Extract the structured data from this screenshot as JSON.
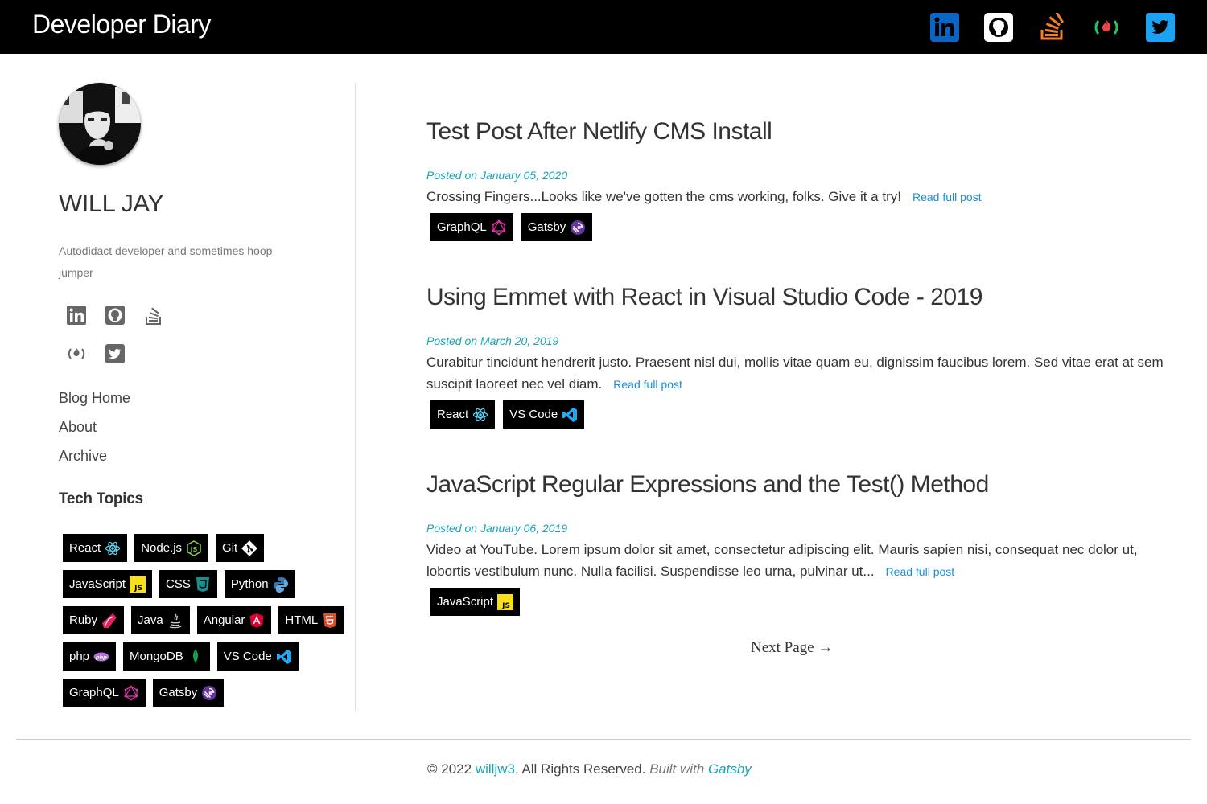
{
  "site": {
    "title": "Developer Diary"
  },
  "header": {
    "social": [
      {
        "name": "linkedin-icon",
        "color": "#0a66c2"
      },
      {
        "name": "github-icon",
        "color": "#ffffff"
      },
      {
        "name": "stackoverflow-icon",
        "color": "#f48024"
      },
      {
        "name": "freecodecamp-icon",
        "color": "#22c55e"
      },
      {
        "name": "twitter-icon",
        "color": "#1da1f2"
      }
    ]
  },
  "sidebar": {
    "author": "WILL JAY",
    "tagline": "Autodidact developer and sometimes hoop-jumper",
    "social": [
      "linkedin-icon",
      "github-icon",
      "stackoverflow-icon",
      "freecodecamp-icon",
      "twitter-icon"
    ],
    "nav": [
      "Blog Home",
      "About",
      "Archive"
    ],
    "topics_title": "Tech Topics",
    "topics": [
      {
        "label": "React",
        "icon": "react-icon"
      },
      {
        "label": "Node.js",
        "icon": "nodejs-icon"
      },
      {
        "label": "Git",
        "icon": "git-icon"
      },
      {
        "label": "JavaScript",
        "icon": "javascript-icon"
      },
      {
        "label": "CSS",
        "icon": "css-icon"
      },
      {
        "label": "Python",
        "icon": "python-icon"
      },
      {
        "label": "Ruby",
        "icon": "ruby-icon"
      },
      {
        "label": "Java",
        "icon": "java-icon"
      },
      {
        "label": "Angular",
        "icon": "angular-icon"
      },
      {
        "label": "HTML",
        "icon": "html-icon"
      },
      {
        "label": "php",
        "icon": "php-icon"
      },
      {
        "label": "MongoDB",
        "icon": "mongodb-icon"
      },
      {
        "label": "VS Code",
        "icon": "vscode-icon"
      },
      {
        "label": "GraphQL",
        "icon": "graphql-icon"
      },
      {
        "label": "Gatsby",
        "icon": "gatsby-icon"
      }
    ]
  },
  "posts": [
    {
      "title": "Test Post After Netlify CMS Install",
      "date": "Posted on January 05, 2020",
      "excerpt": "Crossing Fingers...Looks like we've gotten the cms working, folks. Give it a try!",
      "read_more": "Read full post",
      "tags": [
        {
          "label": "GraphQL",
          "icon": "graphql-icon"
        },
        {
          "label": "Gatsby",
          "icon": "gatsby-icon"
        }
      ]
    },
    {
      "title": "Using Emmet with React in Visual Studio Code - 2019",
      "date": "Posted on March 20, 2019",
      "excerpt": "Curabitur tincidunt hendrerit justo. Praesent nisl dui, mollis vitae quam eu, dignissim faucibus lorem. Sed vitae erat at sem suscipit laoreet nec vel diam.",
      "read_more": "Read full post",
      "tags": [
        {
          "label": "React",
          "icon": "react-icon"
        },
        {
          "label": "VS Code",
          "icon": "vscode-icon"
        }
      ]
    },
    {
      "title": "JavaScript Regular Expressions and the Test() Method",
      "date": "Posted on January 06, 2019",
      "excerpt": "Video at YouTube. Lorem ipsum dolor sit amet, consectetur adipiscing elit. Mauris sapien nisi, consequat nec dolor ut, lobortis vestibulum nunc. Nulla facilisi. Suspendisse leo urna, pulvinar ut...",
      "read_more": "Read full post",
      "tags": [
        {
          "label": "JavaScript",
          "icon": "javascript-icon"
        }
      ]
    }
  ],
  "pagination": {
    "next": "Next Page →"
  },
  "footer": {
    "copyright": "© 2022",
    "author_link": "willjw3",
    "rights": ", All Rights Reserved.",
    "built_with": "Built with",
    "built_link": "Gatsby"
  }
}
